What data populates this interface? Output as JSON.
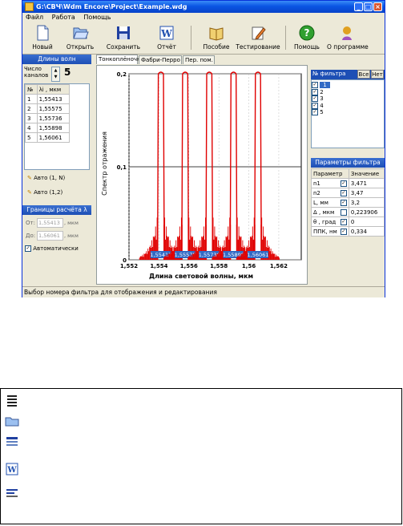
{
  "window": {
    "title": "G:\\СВЧ\\Wdm Encore\\Project\\Example.wdg",
    "buttons": [
      "_",
      "□",
      "×"
    ]
  },
  "menu": [
    "Файл",
    "Работа",
    "Помощь"
  ],
  "toolbar": [
    {
      "label": "Новый",
      "icon": "new-file-icon"
    },
    {
      "label": "Открыть",
      "icon": "open-folder-icon"
    },
    {
      "label": "Сохранить",
      "icon": "save-icon"
    },
    {
      "label": "Отчёт",
      "icon": "word-report-icon"
    },
    {
      "label": "Пособие",
      "icon": "book-icon"
    },
    {
      "label": "Тестирование",
      "icon": "test-pencil-icon"
    },
    {
      "label": "Помощь",
      "icon": "help-icon"
    },
    {
      "label": "О программе",
      "icon": "about-icon"
    }
  ],
  "left": {
    "wavelengths_header": "Длины волн",
    "channels_label": "Число\nканалов",
    "channels_value": "5",
    "table_header": [
      "№",
      "λi , мкм"
    ],
    "rows": [
      [
        "1",
        "1,55413"
      ],
      [
        "2",
        "1,55575"
      ],
      [
        "3",
        "1,55736"
      ],
      [
        "4",
        "1,55898"
      ],
      [
        "5",
        "1,56061"
      ]
    ],
    "auto1": "Авто (1, N)",
    "auto2": "Авто (1,2)",
    "bounds_header": "Границы расчёта λ",
    "from_label": "От:",
    "from_value": "1,55413",
    "to_label": "До:",
    "to_value": "1,56061",
    "unit": ", мкм",
    "auto_check": "Автоматически"
  },
  "tabs": [
    "Тонкоплёночный",
    "Фабри-Перро",
    "Пер. пом."
  ],
  "chart_data": {
    "type": "line",
    "ylabel": "Спектр отражения",
    "xlabel": "Длина световой волны, мкм",
    "xlim": [
      1.552,
      1.5635
    ],
    "ylim": [
      0,
      0.2
    ],
    "xticks": [
      "1,552",
      "1,554",
      "1,556",
      "1,558",
      "1,56",
      "1,562"
    ],
    "yticks": [
      "0",
      "0,1",
      "0,2"
    ],
    "peaks": [
      1.55413,
      1.55575,
      1.55736,
      1.55898,
      1.56061
    ],
    "peak_labels": [
      "1,55413",
      "1,55575",
      "1,55736",
      "1,55898",
      "1,56061"
    ],
    "peak_value": 0.2,
    "threshold": 0.1,
    "series_color": "#e00000"
  },
  "right": {
    "filter_header": "№ фильтра",
    "all_btn": "Все",
    "none_btn": "Нет",
    "filters": [
      "1",
      "2",
      "3",
      "4",
      "5"
    ],
    "params_header": "Параметры фильтра",
    "param_cols": [
      "Параметр",
      "Значение"
    ],
    "params": [
      [
        "n1",
        "3,471"
      ],
      [
        "n2",
        "3,47"
      ],
      [
        "L, мм",
        "3,2"
      ],
      [
        "Δ , мкм",
        "0,223906"
      ],
      [
        "θ , град",
        "0"
      ],
      [
        "ППК, нм",
        "0,334"
      ]
    ]
  },
  "status": "Выбор номера фильтра для отображения и редактирования"
}
